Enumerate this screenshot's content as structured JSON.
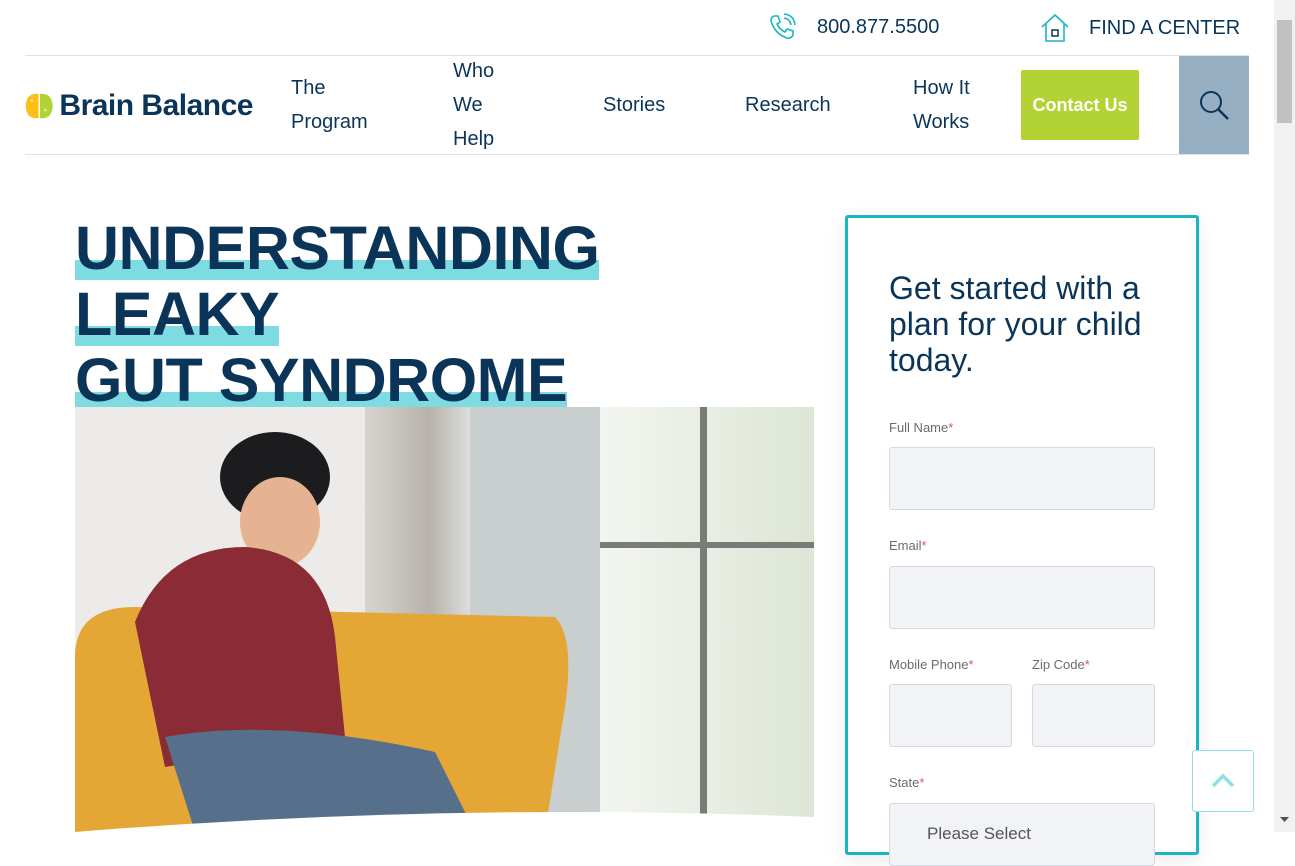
{
  "topbar": {
    "phone": "800.877.5500",
    "find_center": "FIND A CENTER"
  },
  "nav": {
    "logo": "Brain Balance",
    "items": [
      "The\nProgram",
      "Who\nWe\nHelp",
      "Stories",
      "Research",
      "How It\nWorks"
    ],
    "contact": "Contact Us",
    "search_icon": "search-icon"
  },
  "main": {
    "title_line1": "UNDERSTANDING LEAKY",
    "title_line2": "GUT SYNDROME"
  },
  "form": {
    "heading": "Get started with a plan for your child today.",
    "full_name": "Full Name",
    "email": "Email",
    "mobile": "Mobile Phone",
    "zip": "Zip Code",
    "state": "State",
    "state_placeholder": "Please Select",
    "required": "*"
  },
  "colors": {
    "accent": "#1ab5c1",
    "brand_navy": "#0b3558",
    "contact_green": "#b3d334"
  }
}
